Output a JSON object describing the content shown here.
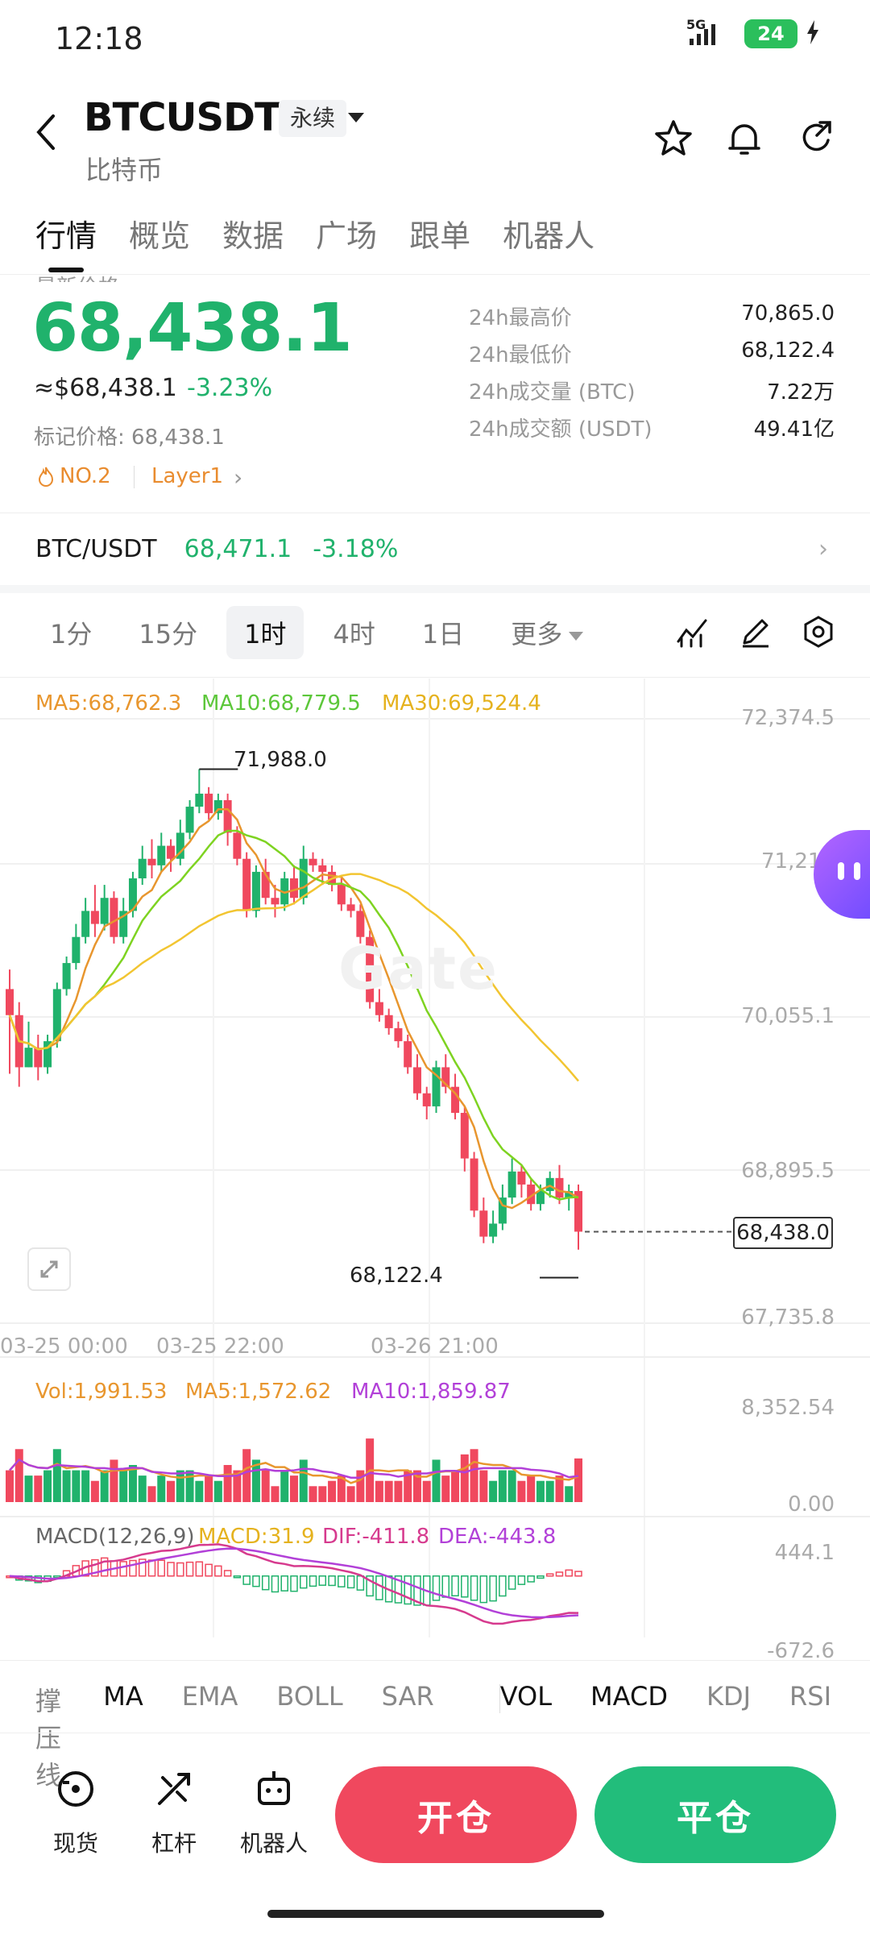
{
  "status_bar": {
    "time": "12:18",
    "network": "5G",
    "battery": "24"
  },
  "header": {
    "symbol": "BTCUSDT",
    "contract_type": "永续",
    "name": "比特币"
  },
  "tabs": [
    {
      "label": "行情",
      "active": true
    },
    {
      "label": "概览"
    },
    {
      "label": "数据"
    },
    {
      "label": "广场"
    },
    {
      "label": "跟单"
    },
    {
      "label": "机器人"
    }
  ],
  "ticker": {
    "label": "最新价格",
    "last_price": "68,438.1",
    "usd_price": "≈$68,438.1",
    "change_pct": "-3.23%",
    "mark_price": "标记价格: 68,438.1",
    "rank_tag": "NO.2",
    "sector_tag": "Layer1",
    "stats": [
      {
        "label": "24h最高价",
        "value": "70,865.0"
      },
      {
        "label": "24h最低价",
        "value": "68,122.4"
      },
      {
        "label": "24h成交量 (BTC)",
        "value": "7.22万"
      },
      {
        "label": "24h成交额 (USDT)",
        "value": "49.41亿"
      }
    ]
  },
  "spot": {
    "pair": "BTC/USDT",
    "price": "68,471.1",
    "change": "-3.18%"
  },
  "timeframes": {
    "items": [
      "1分",
      "15分",
      "1时",
      "4时",
      "1日"
    ],
    "active": "1时",
    "more": "更多"
  },
  "colors": {
    "up": "#20b26c",
    "down": "#f0485e",
    "ma5": "#e8962e",
    "ma10": "#7ed321",
    "ma30": "#f2c531",
    "vol_ma10": "#b240d8",
    "dif": "#d63a8e",
    "dea": "#b240d8"
  },
  "chart": {
    "ma5": "MA5:68,762.3",
    "ma10": "MA10:68,779.5",
    "ma30": "MA30:69,524.4",
    "y_ticks": [
      "72,374.5",
      "71,214",
      "70,055.1",
      "68,895.5",
      "67,735.8"
    ],
    "x_ticks": [
      "03-25 00:00",
      "03-25 22:00",
      "03-26 21:00"
    ],
    "high_label": "71,988.0",
    "low_label": "68,122.4",
    "current_price": "68,438.0",
    "watermark": "Gate"
  },
  "chart_data": {
    "type": "candlestick",
    "ylim": [
      67735.8,
      72374.5
    ],
    "high": 71988.0,
    "low": 68122.4,
    "last": 68438.0,
    "candles": [
      [
        70300,
        70100,
        70450,
        69650
      ],
      [
        70100,
        69700,
        70200,
        69550
      ],
      [
        69700,
        69850,
        70050,
        69700
      ],
      [
        69850,
        69700,
        69950,
        69600
      ],
      [
        69700,
        69900,
        69950,
        69650
      ],
      [
        69900,
        70300,
        70350,
        69850
      ],
      [
        70300,
        70500,
        70550,
        70250
      ],
      [
        70500,
        70700,
        70800,
        70450
      ],
      [
        70700,
        70900,
        71000,
        70650
      ],
      [
        70900,
        70800,
        71100,
        70700
      ],
      [
        70800,
        71000,
        71100,
        70750
      ],
      [
        71000,
        70700,
        71050,
        70650
      ],
      [
        70700,
        70900,
        71000,
        70650
      ],
      [
        70900,
        71150,
        71200,
        70850
      ],
      [
        71150,
        71300,
        71400,
        71100
      ],
      [
        71300,
        71250,
        71450,
        71150
      ],
      [
        71250,
        71400,
        71500,
        71200
      ],
      [
        71400,
        71300,
        71450,
        71200
      ],
      [
        71300,
        71500,
        71600,
        71250
      ],
      [
        71500,
        71700,
        71750,
        71450
      ],
      [
        71700,
        71800,
        71988,
        71650
      ],
      [
        71800,
        71650,
        71850,
        71600
      ],
      [
        71650,
        71750,
        71800,
        71600
      ],
      [
        71750,
        71500,
        71800,
        71400
      ],
      [
        71500,
        71300,
        71550,
        71250
      ],
      [
        71300,
        70900,
        71350,
        70850
      ],
      [
        70900,
        71200,
        71250,
        70850
      ],
      [
        71200,
        71000,
        71300,
        70950
      ],
      [
        71000,
        70950,
        71100,
        70850
      ],
      [
        70950,
        71150,
        71200,
        70900
      ],
      [
        71150,
        71000,
        71250,
        70950
      ],
      [
        71000,
        71300,
        71400,
        70950
      ],
      [
        71300,
        71250,
        71350,
        71200
      ],
      [
        71250,
        71200,
        71300,
        71100
      ],
      [
        71200,
        71100,
        71250,
        71050
      ],
      [
        71100,
        70950,
        71150,
        70900
      ],
      [
        70950,
        70900,
        71000,
        70850
      ],
      [
        70900,
        70700,
        70950,
        70650
      ],
      [
        70700,
        70200,
        70750,
        70150
      ],
      [
        70200,
        70100,
        70300,
        70050
      ],
      [
        70100,
        70000,
        70150,
        69950
      ],
      [
        70000,
        69900,
        70050,
        69850
      ],
      [
        69900,
        69700,
        69950,
        69650
      ],
      [
        69700,
        69500,
        69800,
        69450
      ],
      [
        69500,
        69400,
        69550,
        69300
      ],
      [
        69400,
        69700,
        69750,
        69350
      ],
      [
        69700,
        69550,
        69800,
        69500
      ],
      [
        69550,
        69350,
        69650,
        69300
      ],
      [
        69350,
        69000,
        69400,
        68900
      ],
      [
        69000,
        68600,
        69050,
        68550
      ],
      [
        68600,
        68400,
        68700,
        68350
      ],
      [
        68400,
        68500,
        68600,
        68350
      ],
      [
        68500,
        68700,
        68800,
        68450
      ],
      [
        68700,
        68900,
        69000,
        68650
      ],
      [
        68900,
        68800,
        68950,
        68700
      ],
      [
        68800,
        68650,
        68850,
        68600
      ],
      [
        68650,
        68750,
        68800,
        68600
      ],
      [
        68750,
        68850,
        68900,
        68700
      ],
      [
        68850,
        68700,
        68950,
        68650
      ],
      [
        68700,
        68750,
        68800,
        68600
      ],
      [
        68750,
        68438,
        68800,
        68300
      ]
    ],
    "volume": {
      "vol": 1991.53,
      "ma5": 1572.62,
      "ma10": 1859.87,
      "ylim": [
        0,
        8352.54
      ]
    },
    "macd": {
      "params": "MACD(12,26,9)",
      "macd": 31.9,
      "dif": -411.8,
      "dea": -443.8,
      "ylim": [
        -672.6,
        444.1
      ]
    }
  },
  "volume_legend": {
    "vol": "Vol:1,991.53",
    "ma5": "MA5:1,572.62",
    "ma10": "MA10:1,859.87",
    "top": "8,352.54",
    "bottom": "0.00"
  },
  "macd_legend": {
    "name": "MACD(12,26,9)",
    "macd": "MACD:31.9",
    "dif": "DIF:-411.8",
    "dea": "DEA:-443.8",
    "top": "444.1",
    "bottom": "-672.6"
  },
  "indicators": {
    "main": [
      "撑压线",
      "MA",
      "EMA",
      "BOLL",
      "SAR"
    ],
    "sub": [
      "VOL",
      "MACD",
      "KDJ",
      "RSI"
    ],
    "active": [
      "MA",
      "VOL",
      "MACD"
    ]
  },
  "bottom_nav": {
    "spot": "现货",
    "leverage": "杠杆",
    "bot": "机器人",
    "open": "开仓",
    "close": "平仓"
  }
}
